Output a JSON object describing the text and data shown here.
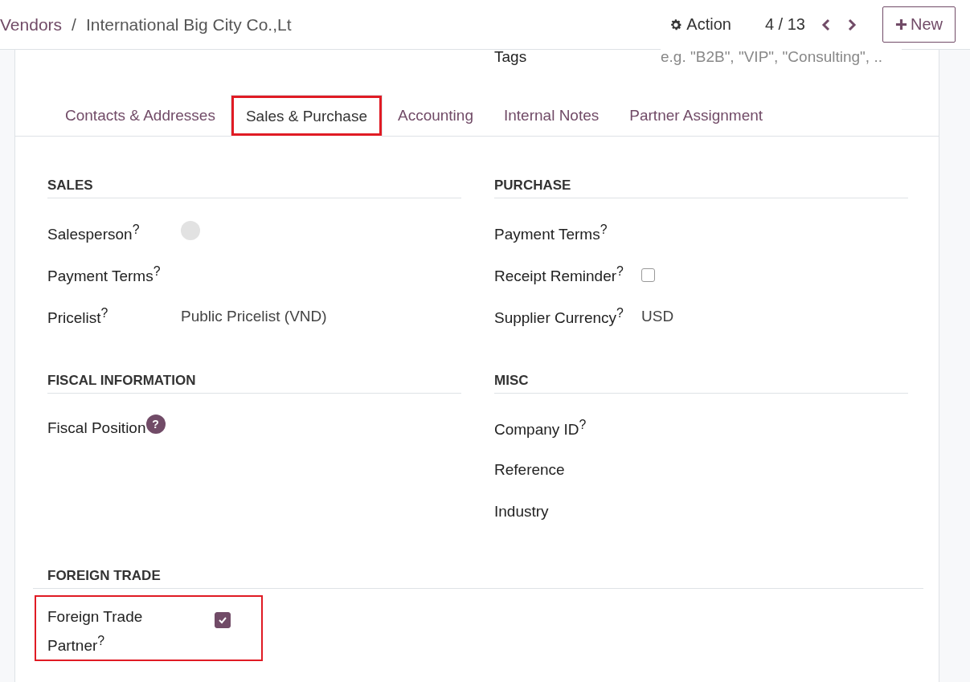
{
  "breadcrumb": {
    "parent": "Vendors",
    "separator": "/",
    "current": "International Big City Co.,Lt"
  },
  "toolbar": {
    "action": "Action",
    "pager": "4 / 13",
    "new_button": "New"
  },
  "tags": {
    "label": "Tags",
    "placeholder": "e.g. \"B2B\", \"VIP\", \"Consulting\", .."
  },
  "tabs": [
    {
      "label": "Contacts & Addresses",
      "selected": false,
      "highlighted": false
    },
    {
      "label": "Sales & Purchase",
      "selected": true,
      "highlighted": true
    },
    {
      "label": "Accounting",
      "selected": false,
      "highlighted": false
    },
    {
      "label": "Internal Notes",
      "selected": false,
      "highlighted": false
    },
    {
      "label": "Partner Assignment",
      "selected": false,
      "highlighted": false
    }
  ],
  "sections": [
    {
      "title": "SALES",
      "fields": [
        {
          "kind": "avatar",
          "label": "Salesperson$^{?}$"
        },
        {
          "kind": "empty",
          "label": "Payment Terms$^{?}$"
        },
        {
          "kind": "text",
          "label": "Pricelist$^{?}$",
          "value": "Public Pricelist (VND)"
        }
      ]
    },
    {
      "title": "PURCHASE",
      "fields": [
        {
          "kind": "empty",
          "label": "Payment Terms$^{?}$"
        },
        {
          "kind": "checkbox",
          "label": "Receipt Reminder$^{?}$",
          "checked": false
        },
        {
          "kind": "text",
          "label": "Supplier Currency$^{?}$",
          "value": "USD"
        }
      ]
    },
    {
      "title": "FISCAL INFORMATION",
      "fields": [
        {
          "kind": "empty",
          "label": "Fiscal Position",
          "badge": "?"
        }
      ]
    },
    {
      "title": "MISC",
      "fields": [
        {
          "kind": "empty",
          "label": "Company ID$^{?}$"
        },
        {
          "kind": "empty",
          "label": "Reference"
        },
        {
          "kind": "empty",
          "label": "Industry"
        }
      ]
    }
  ],
  "foreign_trade": {
    "title": "FOREIGN TRADE",
    "fields": [
      {
        "kind": "checkbox",
        "label": "Foreign Trade Partner$^{?}$",
        "checked": true,
        "highlighted": true
      }
    ]
  }
}
